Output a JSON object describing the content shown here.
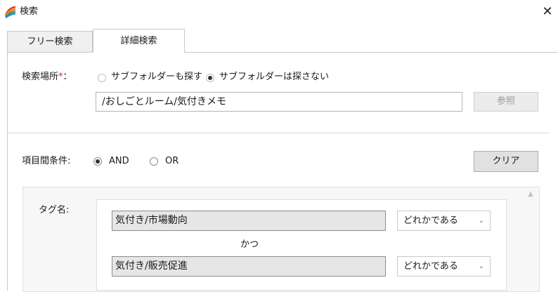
{
  "window": {
    "title": "検索",
    "close_glyph": "✕"
  },
  "tabs": [
    {
      "label": "フリー検索",
      "active": false
    },
    {
      "label": "詳細検索",
      "active": true
    }
  ],
  "location": {
    "label": "検索場所",
    "required_mark": "*",
    "colon": "：",
    "options": [
      {
        "label": "サブフォルダーも探す",
        "selected": false
      },
      {
        "label": "サブフォルダーは探さない",
        "selected": true
      }
    ],
    "path": "/おしごとルーム/気付きメモ",
    "browse_label": "参照"
  },
  "condition": {
    "label": "項目間条件:",
    "options": [
      {
        "label": "AND",
        "selected": true
      },
      {
        "label": "OR",
        "selected": false
      }
    ],
    "clear_label": "クリア"
  },
  "tags": {
    "label": "タグ名:",
    "connector": "かつ",
    "rows": [
      {
        "value": "気付き/市場動向",
        "match": "どれかである"
      },
      {
        "value": "気付き/販売促進",
        "match": "どれかである"
      }
    ]
  },
  "colors": {
    "required": "#e0195a",
    "disabled_text": "#9a9a9a"
  }
}
